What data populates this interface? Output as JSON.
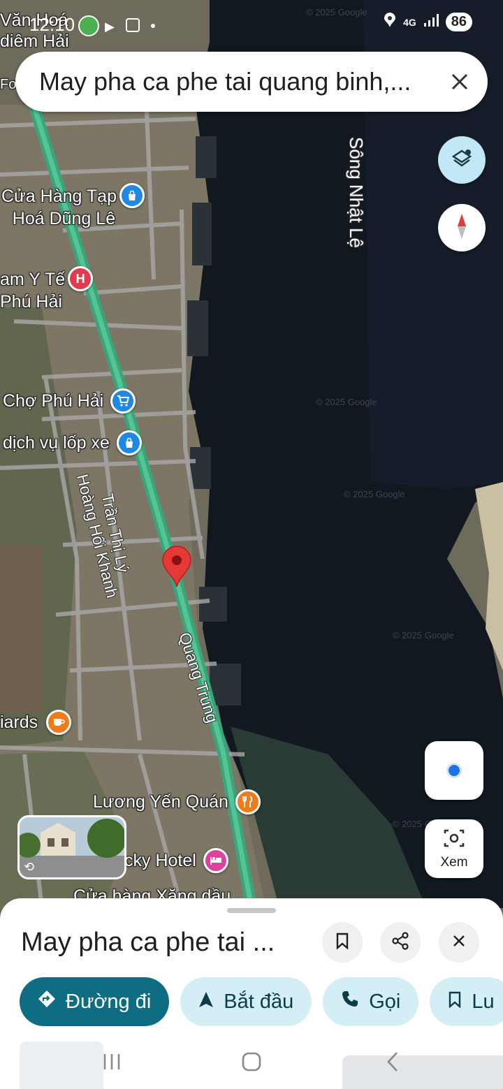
{
  "status_bar": {
    "time": "12:10",
    "network": "4G",
    "battery": "86"
  },
  "search": {
    "query": "May pha ca phe tai quang binh,..."
  },
  "map": {
    "river_label": "Sông Nhật Lệ",
    "pois": [
      {
        "id": "van-hoa",
        "label": "Văn Hoá\ndiêm Hải"
      },
      {
        "id": "store-dung-le",
        "label": "Cửa Hàng Tạp\nHoá Dũng Lê",
        "icon": "shopping-bag-icon"
      },
      {
        "id": "clinic",
        "label": "am Y Tế\nPhú Hải",
        "icon": "hospital-icon"
      },
      {
        "id": "market",
        "label": "Chợ Phú Hải",
        "icon": "shopping-cart-icon"
      },
      {
        "id": "tire",
        "label": "dịch vụ lốp xe",
        "icon": "shopping-bag-icon"
      },
      {
        "id": "billiards",
        "label": "iards",
        "icon": "cafe-icon"
      },
      {
        "id": "luong-yen",
        "label": "Lương Yến Quán",
        "icon": "restaurant-icon"
      },
      {
        "id": "hotel",
        "label": "cky Hotel",
        "icon": "hotel-icon"
      },
      {
        "id": "gas",
        "label": "Cửa hàng Xăng dầu"
      }
    ],
    "roads": [
      "Trần Thị Lý",
      "Hoàng Hối Khanh",
      "Quang Trung"
    ],
    "fo_label": "Fo"
  },
  "buttons": {
    "explore_label": "Xem"
  },
  "sheet": {
    "title": "May pha ca phe tai ...",
    "chips": [
      {
        "label": "Đường đi",
        "icon": "directions-icon"
      },
      {
        "label": "Bắt đầu",
        "icon": "navigation-arrow-icon"
      },
      {
        "label": "Gọi",
        "icon": "phone-icon"
      },
      {
        "label": "Lu",
        "icon": "bookmark-icon"
      }
    ]
  },
  "colors": {
    "accent": "#0e6d82",
    "chip_bg": "#d3eef5",
    "pin_red": "#e53935"
  }
}
